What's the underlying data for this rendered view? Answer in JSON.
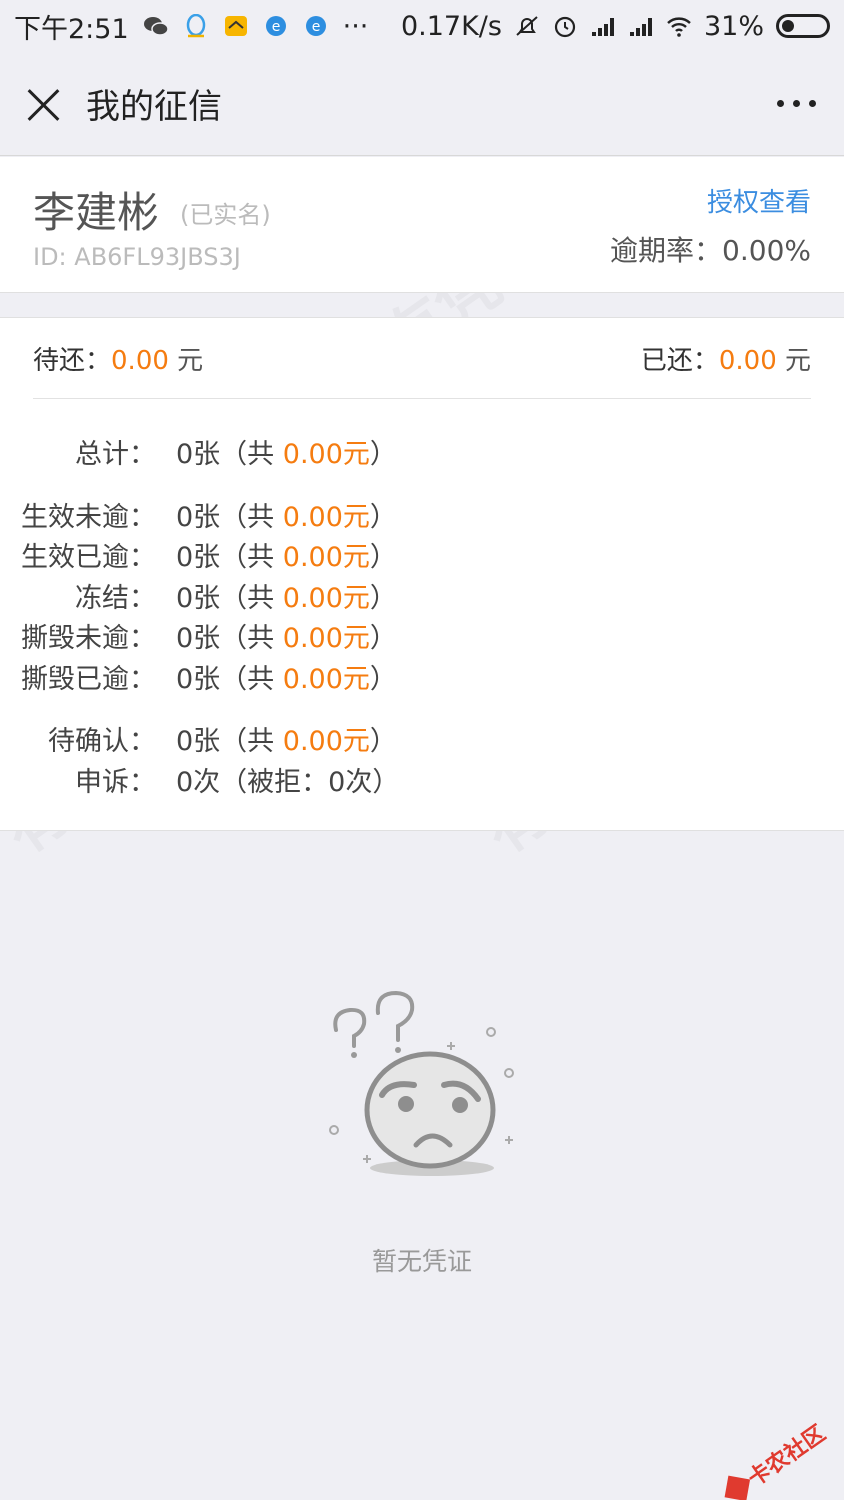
{
  "status_bar": {
    "time": "下午2:51",
    "more": "···",
    "speed": "0.17K/s",
    "battery": "31%"
  },
  "nav": {
    "title": "我的征信"
  },
  "profile": {
    "name": "李建彬",
    "verified": "(已实名)",
    "id": "ID: AB6FL93JBS3J",
    "auth_link": "授权查看",
    "overdue_label": "逾期率：",
    "overdue_value": "0.00%"
  },
  "summary": {
    "pending_label": "待还：",
    "pending_amount": "0.00",
    "pending_unit": " 元",
    "paid_label": "已还：",
    "paid_amount": "0.00",
    "paid_unit": " 元",
    "rows": [
      {
        "label": "总计：",
        "pre": "0张（共 ",
        "amount": "0.00元",
        "post": "）"
      },
      {
        "label": "生效未逾：",
        "pre": "0张（共 ",
        "amount": "0.00元",
        "post": "）"
      },
      {
        "label": "生效已逾：",
        "pre": "0张（共 ",
        "amount": "0.00元",
        "post": "）"
      },
      {
        "label": "冻结：",
        "pre": "0张（共 ",
        "amount": "0.00元",
        "post": "）"
      },
      {
        "label": "撕毁未逾：",
        "pre": "0张（共 ",
        "amount": "0.00元",
        "post": "）"
      },
      {
        "label": "撕毁已逾：",
        "pre": "0张（共 ",
        "amount": "0.00元",
        "post": "）"
      },
      {
        "label": "待确认：",
        "pre": "0张（共 ",
        "amount": "0.00元",
        "post": "）"
      },
      {
        "label": "申诉：",
        "pre": "0次（被拒：0次）",
        "amount": "",
        "post": ""
      }
    ]
  },
  "empty_state": {
    "text": "暂无凭证"
  },
  "watermark": {
    "text": "有凭证防伪"
  },
  "corner_logo": {
    "text": "卡农社区"
  },
  "colors": {
    "accent_orange": "#f57c10",
    "link_blue": "#3b8de0"
  }
}
